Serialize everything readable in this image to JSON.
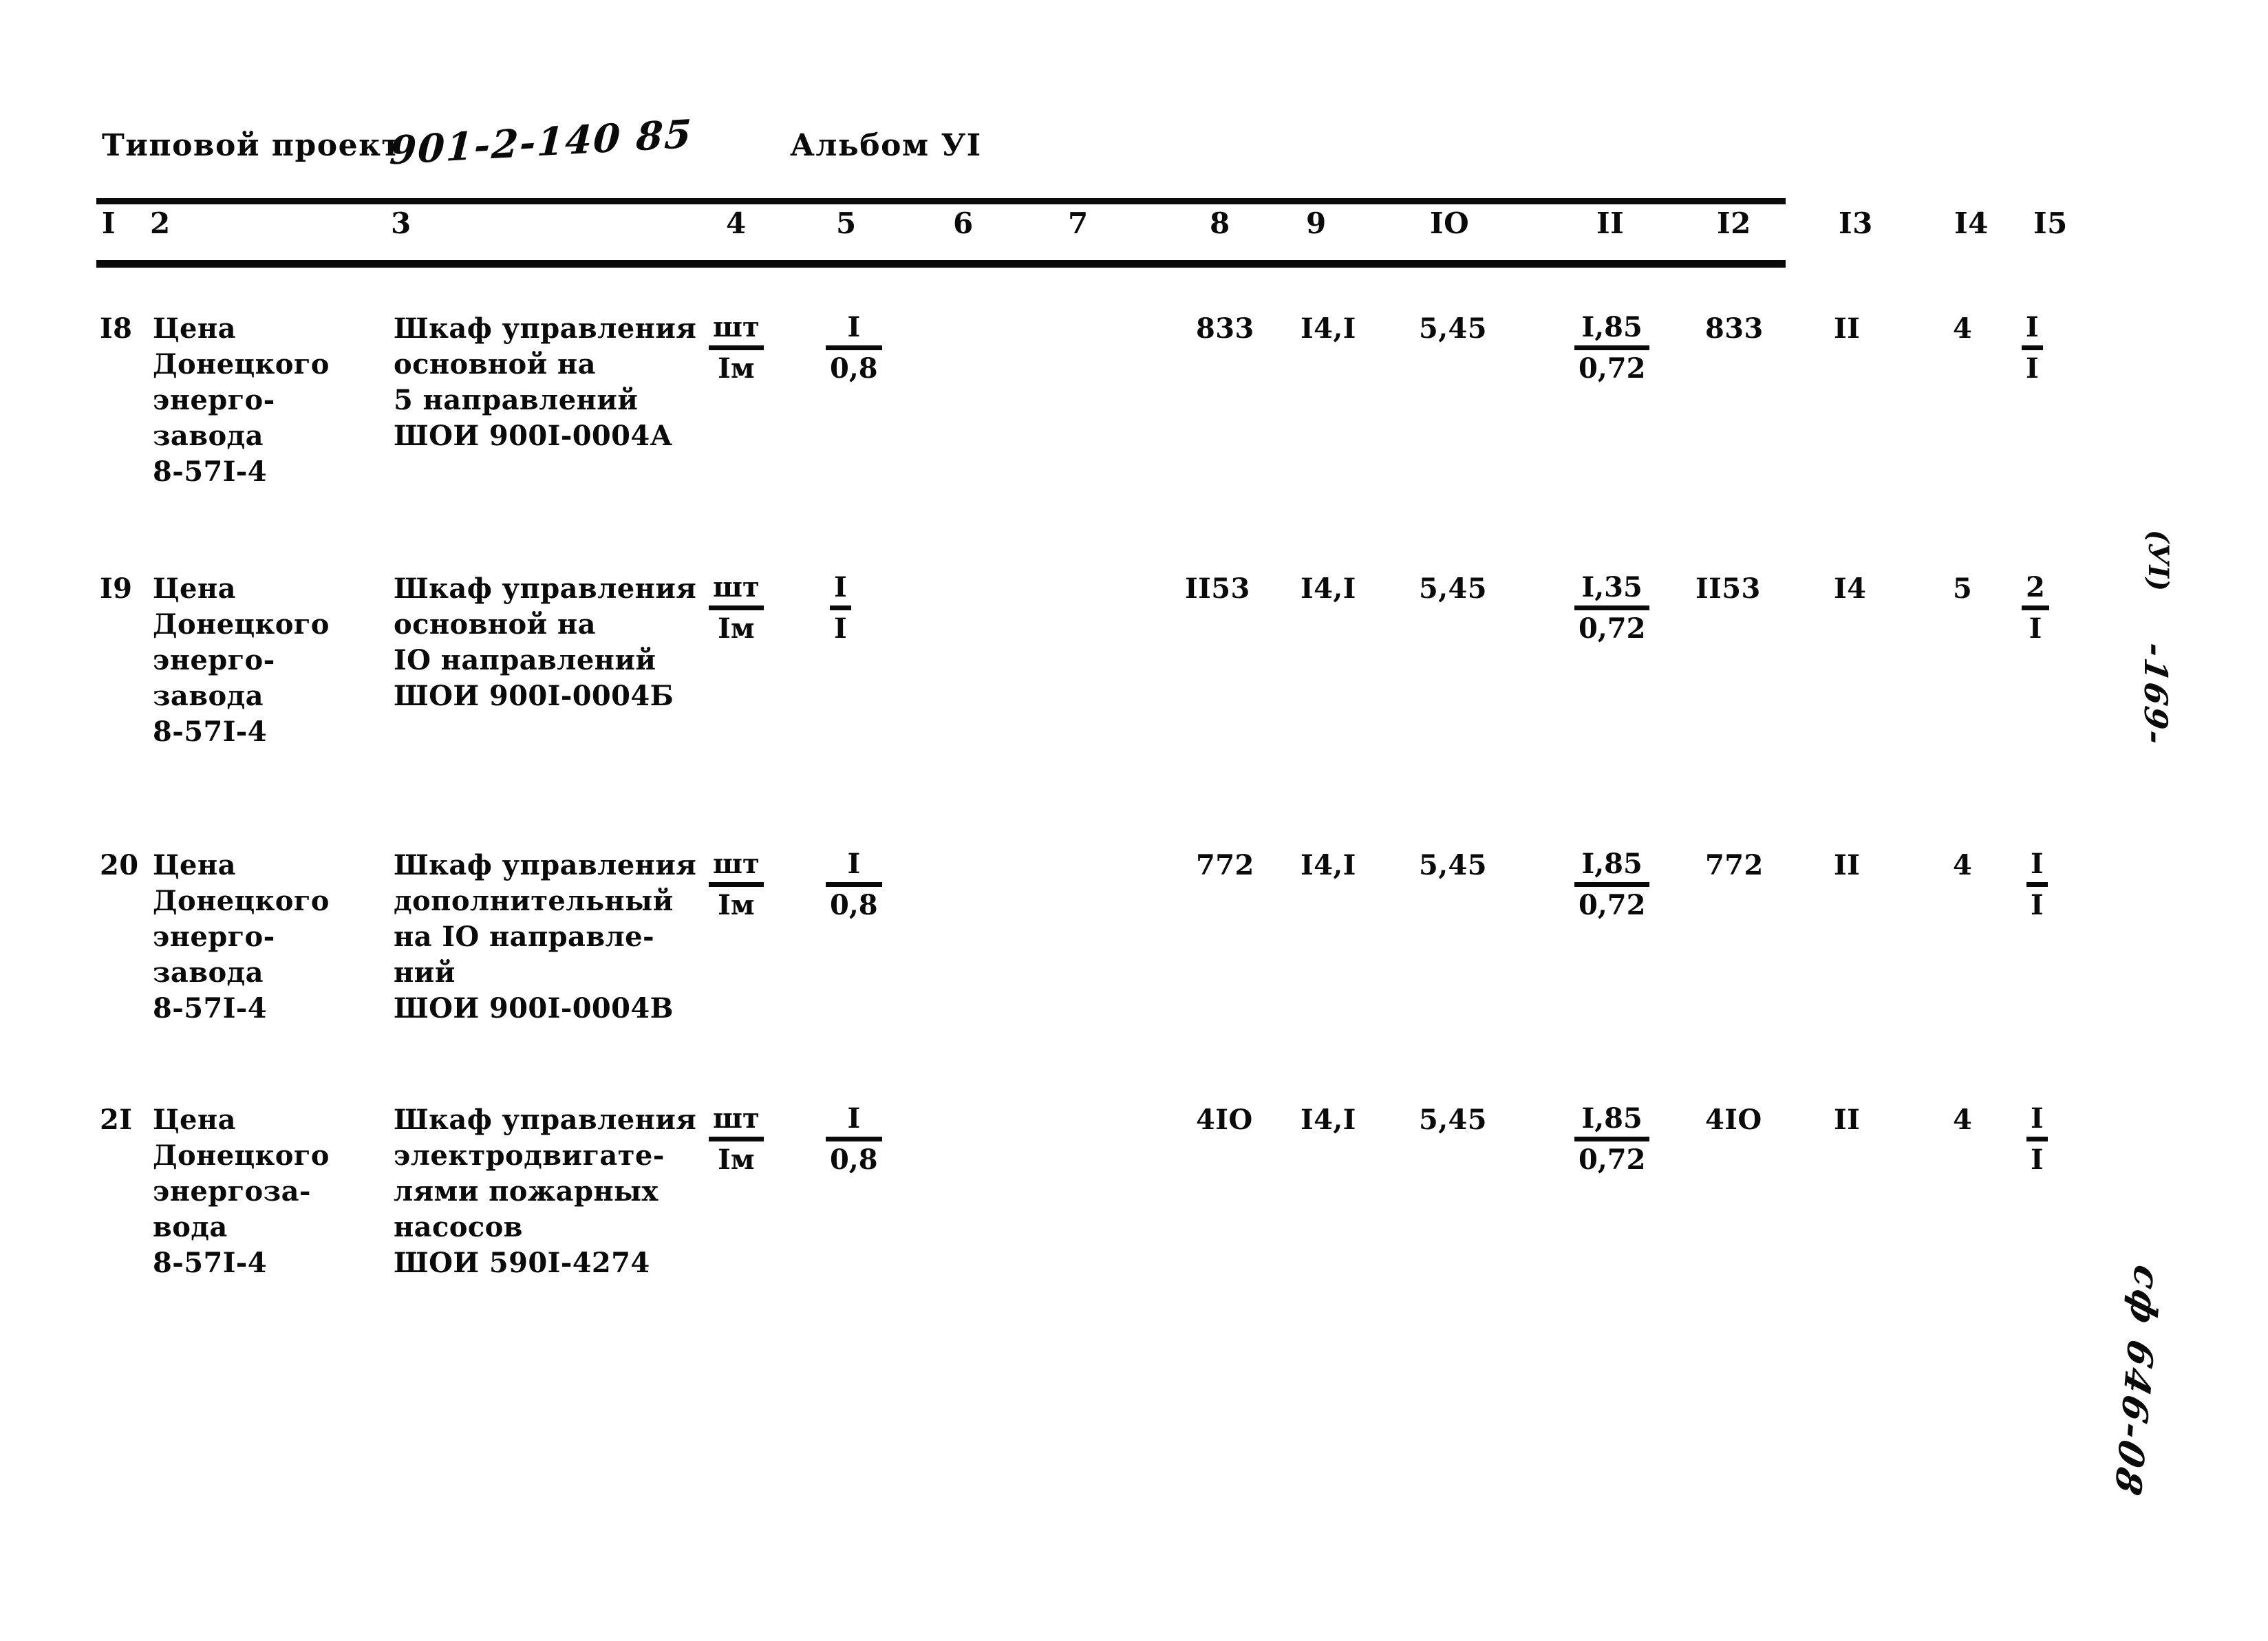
{
  "document": {
    "header": {
      "project_label": "Типовой проект",
      "project_code": "901-2-140 85",
      "album_label": "Альбом УI"
    },
    "column_headers": [
      "I",
      "2",
      "3",
      "4",
      "5",
      "6",
      "7",
      "8",
      "9",
      "IO",
      "II",
      "I2",
      "I3",
      "I4",
      "I5"
    ],
    "margin_notes": {
      "album_marker": "(УI)",
      "page_number": "-169-",
      "archive_stamp": "сф 646-08"
    }
  },
  "table": {
    "rows": [
      {
        "c1": "I8",
        "c2": "Цена\nДонецкого\nэнерго-\nзавода\n8-57I-4",
        "c3": "Шкаф управления\nосновной на\n5 направлений\nШОИ 900I-0004А",
        "c4_top": "шт",
        "c4_bot": "Iм",
        "c5_top": "I",
        "c5_bot": "0,8",
        "c6": "",
        "c7": "",
        "c8": "833",
        "c9": "I4,I",
        "c10": "5,45",
        "c11_top": "I,85",
        "c11_bot": "0,72",
        "c12": "833",
        "c13": "II",
        "c14": "4",
        "c15_top": "I",
        "c15_bot": "I"
      },
      {
        "c1": "I9",
        "c2": "Цена\nДонецкого\nэнерго-\nзавода\n8-57I-4",
        "c3": "Шкаф управления\nосновной на\nIО направлений\nШОИ 900I-0004Б",
        "c4_top": "шт",
        "c4_bot": "Iм",
        "c5_top": "I",
        "c5_bot": "I",
        "c6": "",
        "c7": "",
        "c8": "II53",
        "c9": "I4,I",
        "c10": "5,45",
        "c11_top": "I,35",
        "c11_bot": "0,72",
        "c12": "II53",
        "c13": "I4",
        "c14": "5",
        "c15_top": "2",
        "c15_bot": "I"
      },
      {
        "c1": "20",
        "c2": "Цена\nДонецкого\nэнерго-\nзавода\n8-57I-4",
        "c3": "Шкаф управления\nдополнительный\nна IО направле-\nний\nШОИ 900I-0004В",
        "c4_top": "шт",
        "c4_bot": "Iм",
        "c5_top": "I",
        "c5_bot": "0,8",
        "c6": "",
        "c7": "",
        "c8": "772",
        "c9": "I4,I",
        "c10": "5,45",
        "c11_top": "I,85",
        "c11_bot": "0,72",
        "c12": "772",
        "c13": "II",
        "c14": "4",
        "c15_top": "I",
        "c15_bot": "I"
      },
      {
        "c1": "2I",
        "c2": "Цена\nДонецкого\nэнергоза-\nвода\n8-57I-4",
        "c3": "Шкаф управления\nэлектродвигате-\nлями пожарных\nнасосов\nШОИ 590I-4274",
        "c4_top": "шт",
        "c4_bot": "Iм",
        "c5_top": "I",
        "c5_bot": "0,8",
        "c6": "",
        "c7": "",
        "c8": "4IO",
        "c9": "I4,I",
        "c10": "5,45",
        "c11_top": "I,85",
        "c11_bot": "0,72",
        "c12": "4IO",
        "c13": "II",
        "c14": "4",
        "c15_top": "I",
        "c15_bot": "I"
      }
    ]
  }
}
